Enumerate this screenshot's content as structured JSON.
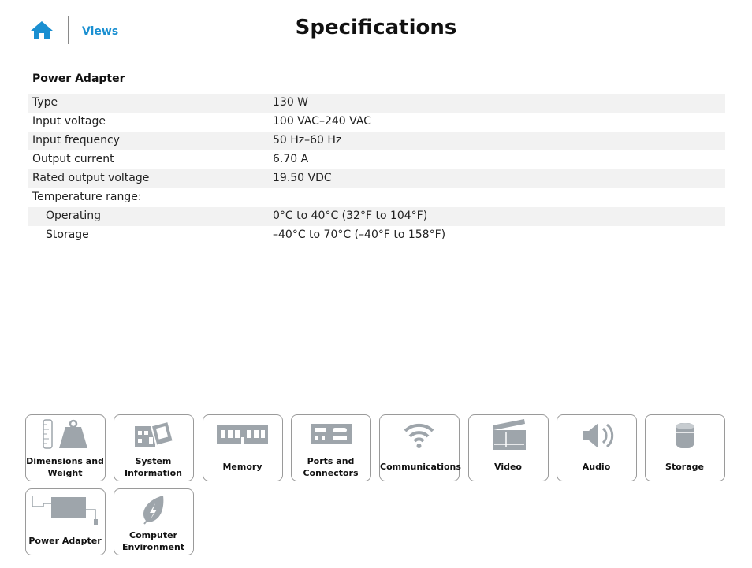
{
  "header": {
    "home_icon": "home-icon",
    "views_label": "Views",
    "title": "Specifications",
    "accent_color": "#1a8fd1"
  },
  "section": {
    "title": "Power Adapter",
    "rows": [
      {
        "label": "Type",
        "value": "130 W"
      },
      {
        "label": "Input voltage",
        "value": "100 VAC–240 VAC"
      },
      {
        "label": "Input frequency",
        "value": "50 Hz–60 Hz"
      },
      {
        "label": "Output current",
        "value": "6.70 A"
      },
      {
        "label": "Rated output voltage",
        "value": "19.50 VDC"
      },
      {
        "label": "Temperature range:",
        "value": ""
      },
      {
        "label": "Operating",
        "value": "0°C to 40°C (32°F to 104°F)"
      },
      {
        "label": "Storage",
        "value": "–40°C to 70°C (–40°F to 158°F)"
      }
    ]
  },
  "tiles": [
    {
      "line1": "Dimensions and",
      "line2": "Weight",
      "icon": "weight-ruler-icon"
    },
    {
      "line1": "System",
      "line2": "Information",
      "icon": "motherboard-icon"
    },
    {
      "line1": "Memory",
      "line2": "",
      "icon": "memory-module-icon"
    },
    {
      "line1": "Ports and",
      "line2": "Connectors",
      "icon": "ports-icon"
    },
    {
      "line1": "Communications",
      "line2": "",
      "icon": "wifi-icon"
    },
    {
      "line1": "Video",
      "line2": "",
      "icon": "clapperboard-icon"
    },
    {
      "line1": "Audio",
      "line2": "",
      "icon": "speaker-icon"
    },
    {
      "line1": "Storage",
      "line2": "",
      "icon": "storage-drive-icon"
    },
    {
      "line1": "Power Adapter",
      "line2": "",
      "icon": "power-adapter-icon"
    },
    {
      "line1": "Computer",
      "line2": "Environment",
      "icon": "leaf-icon"
    }
  ]
}
